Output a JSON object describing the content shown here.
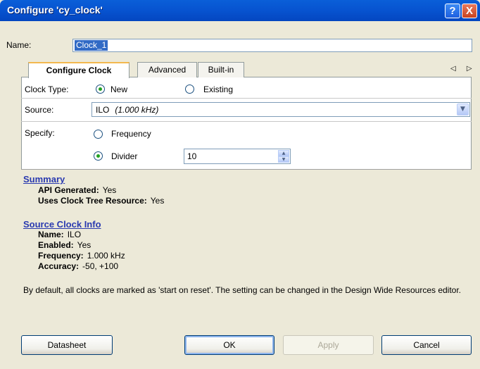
{
  "window": {
    "title": "Configure 'cy_clock'",
    "help_glyph": "?",
    "close_glyph": "X"
  },
  "name": {
    "label": "Name:",
    "value": "Clock_1"
  },
  "tabs": [
    {
      "label": "Configure Clock",
      "active": true
    },
    {
      "label": "Advanced",
      "active": false
    },
    {
      "label": "Built-in",
      "active": false
    }
  ],
  "tab_scroll": "◁ ▷",
  "clock_type": {
    "label": "Clock Type:",
    "options": [
      {
        "label": "New",
        "selected": true
      },
      {
        "label": "Existing",
        "selected": false
      }
    ]
  },
  "source": {
    "label": "Source:",
    "value": "ILO",
    "detail": "(1.000 kHz)"
  },
  "specify": {
    "label": "Specify:",
    "frequency": {
      "label": "Frequency",
      "selected": false
    },
    "divider": {
      "label": "Divider",
      "selected": true,
      "value": "10"
    }
  },
  "summary": {
    "heading": "Summary",
    "rows": [
      {
        "key": "API Generated:",
        "value": "Yes"
      },
      {
        "key": "Uses Clock Tree Resource:",
        "value": "Yes"
      }
    ]
  },
  "source_info": {
    "heading": "Source Clock Info",
    "rows": [
      {
        "key": "Name:",
        "value": "ILO"
      },
      {
        "key": "Enabled:",
        "value": "Yes"
      },
      {
        "key": "Frequency:",
        "value": "1.000 kHz"
      },
      {
        "key": "Accuracy:",
        "value": "-50, +100"
      }
    ]
  },
  "note": "By default, all clocks are marked as 'start on reset'. The setting can be changed in the Design Wide Resources editor.",
  "buttons": {
    "datasheet": "Datasheet",
    "ok": "OK",
    "apply": "Apply",
    "cancel": "Cancel"
  },
  "colors": {
    "title_bar": "#0753d0",
    "dialog_bg": "#ece9d8",
    "link_heading": "#2a3ab0",
    "selection": "#316ac5"
  }
}
